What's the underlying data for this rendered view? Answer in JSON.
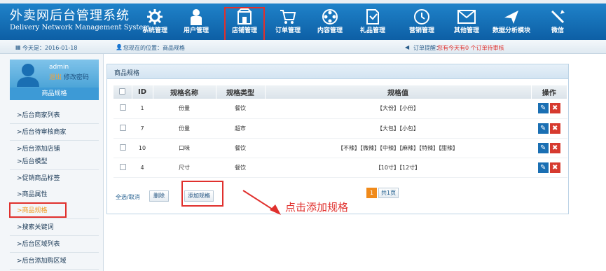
{
  "app": {
    "title_cn": "外卖网后台管理系统",
    "title_en": "Delivery Network Management System"
  },
  "nav": [
    {
      "label": "系统管理",
      "icon": "gear-icon"
    },
    {
      "label": "用户管理",
      "icon": "user-icon"
    },
    {
      "label": "店铺管理",
      "icon": "shop-icon",
      "active": true
    },
    {
      "label": "订单管理",
      "icon": "cart-icon"
    },
    {
      "label": "内容管理",
      "icon": "film-reel-icon"
    },
    {
      "label": "礼品管理",
      "icon": "gift-icon"
    },
    {
      "label": "营销管理",
      "icon": "clock-icon"
    },
    {
      "label": "其他管理",
      "icon": "mail-icon"
    },
    {
      "label": "数据分析模块",
      "icon": "plane-icon"
    },
    {
      "label": "微信",
      "icon": "tools-icon"
    }
  ],
  "infobar": {
    "date_text": "今天是：2016-01-18",
    "location_text": "您现在的位置：商品规格",
    "order_alert_label": "订单提醒：",
    "order_alert_text": "您有今天有0 个订单待审核"
  },
  "user": {
    "name": "admin",
    "logout": "退出",
    "change_password": "修改密码"
  },
  "sidebar": {
    "heading": "商品规格",
    "items": [
      ">后台商家列表",
      ">后台待审核商家",
      ">后台添加店铺",
      ">后台模型",
      ">促销商品标签",
      ">商品属性",
      ">商品规格",
      ">搜索关键词",
      ">后台区域列表",
      ">后台添加购区域"
    ]
  },
  "panel": {
    "title": "商品规格"
  },
  "table": {
    "headers": [
      "",
      "ID",
      "规格名称",
      "规格类型",
      "规格值",
      "操作"
    ],
    "rows": [
      {
        "id": "1",
        "name": "份量",
        "type": "餐饮",
        "values": "【大份】【小份】"
      },
      {
        "id": "7",
        "name": "份量",
        "type": "超市",
        "values": "【大包】【小包】"
      },
      {
        "id": "10",
        "name": "口味",
        "type": "餐饮",
        "values": "【不辣】【微辣】【中辣】【麻辣】【特辣】【甜辣】"
      },
      {
        "id": "4",
        "name": "尺寸",
        "type": "餐饮",
        "values": "【10寸】【12寸】"
      }
    ]
  },
  "footer": {
    "select_all": "全选/取消",
    "delete_label": "删除",
    "add_label": "添加规格",
    "page_current": "1",
    "page_total": "共1页"
  },
  "annotation": {
    "text": "点击添加规格"
  },
  "colors": {
    "header_blue": "#1670bb",
    "highlight_red": "#e0302d",
    "accent_orange": "#f08a1a"
  }
}
